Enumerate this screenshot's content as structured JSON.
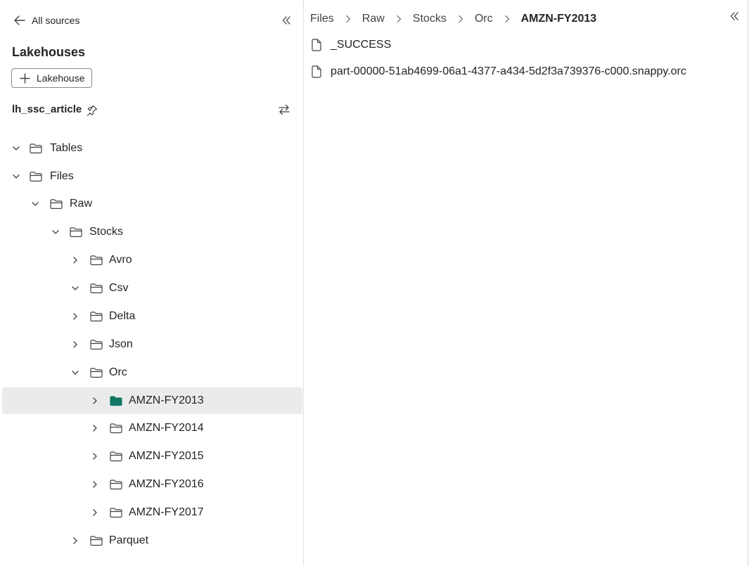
{
  "nav": {
    "back_label": "All sources"
  },
  "lakehouses": {
    "title": "Lakehouses",
    "add_label": "Lakehouse",
    "current": "lh_ssc_article"
  },
  "tree": [
    {
      "label": "Tables",
      "expanded": false
    },
    {
      "label": "Files",
      "expanded": true
    },
    {
      "label": "Raw",
      "expanded": true
    },
    {
      "label": "Stocks",
      "expanded": true
    },
    {
      "label": "Avro",
      "expanded": false
    },
    {
      "label": "Csv",
      "expanded": true
    },
    {
      "label": "Delta",
      "expanded": false
    },
    {
      "label": "Json",
      "expanded": false
    },
    {
      "label": "Orc",
      "expanded": true
    },
    {
      "label": "AMZN-FY2013",
      "expanded": false,
      "selected": true
    },
    {
      "label": "AMZN-FY2014",
      "expanded": false
    },
    {
      "label": "AMZN-FY2015",
      "expanded": false
    },
    {
      "label": "AMZN-FY2016",
      "expanded": false
    },
    {
      "label": "AMZN-FY2017",
      "expanded": false
    },
    {
      "label": "Parquet",
      "expanded": false
    }
  ],
  "breadcrumb": [
    "Files",
    "Raw",
    "Stocks",
    "Orc",
    "AMZN-FY2013"
  ],
  "files": [
    {
      "name": "_SUCCESS"
    },
    {
      "name": "part-00000-51ab4699-06a1-4377-a434-5d2f3a739376-c000.snappy.orc"
    }
  ],
  "colors": {
    "accent_folder": "#117865",
    "selected_bg": "#ebebeb",
    "text": "#242424",
    "icon": "#424242"
  },
  "icons": {
    "back": "arrow-left-icon",
    "collapse": "double-chevron-left-icon",
    "add": "plus-icon",
    "pin": "pin-icon",
    "swap": "swap-arrows-icon",
    "folder": "folder-icon",
    "file": "document-icon",
    "chevron_right": "chevron-right-icon",
    "chevron_down": "chevron-down-icon"
  }
}
